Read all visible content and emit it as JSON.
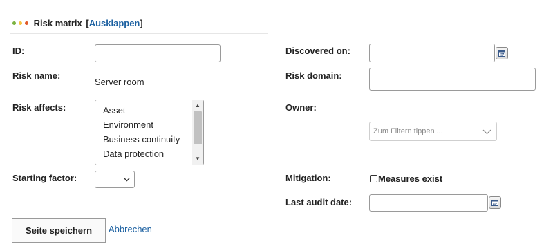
{
  "colors": {
    "dot_green": "#7cb342",
    "dot_yellow": "#f6c342",
    "dot_red": "#e05a2b",
    "link": "#1a5fa0"
  },
  "header": {
    "title": "Risk matrix",
    "bracket_open": "[",
    "toggle_link": "Ausklappen",
    "bracket_close": "]"
  },
  "form": {
    "id_label": "ID:",
    "id_value": "",
    "risk_name_label": "Risk name:",
    "risk_name_value": "Server room",
    "risk_affects_label": "Risk affects:",
    "risk_affects_options": [
      "Asset",
      "Environment",
      "Business continuity",
      "Data protection"
    ],
    "starting_factor_label": "Starting factor:",
    "starting_factor_value": "",
    "discovered_on_label": "Discovered on:",
    "discovered_on_value": "",
    "risk_domain_label": "Risk domain:",
    "risk_domain_value": "",
    "owner_label": "Owner:",
    "owner_placeholder": "Zum Filtern tippen ...",
    "mitigation_label": "Mitigation:",
    "measures_exist_label": "Measures exist",
    "measures_exist_checked": false,
    "last_audit_label": "Last audit date:",
    "last_audit_value": ""
  },
  "actions": {
    "save_label": "Seite speichern",
    "cancel_label": "Abbrechen"
  },
  "icons": {
    "calendar": "calendar-icon",
    "chevron": "chevron-down-icon"
  }
}
